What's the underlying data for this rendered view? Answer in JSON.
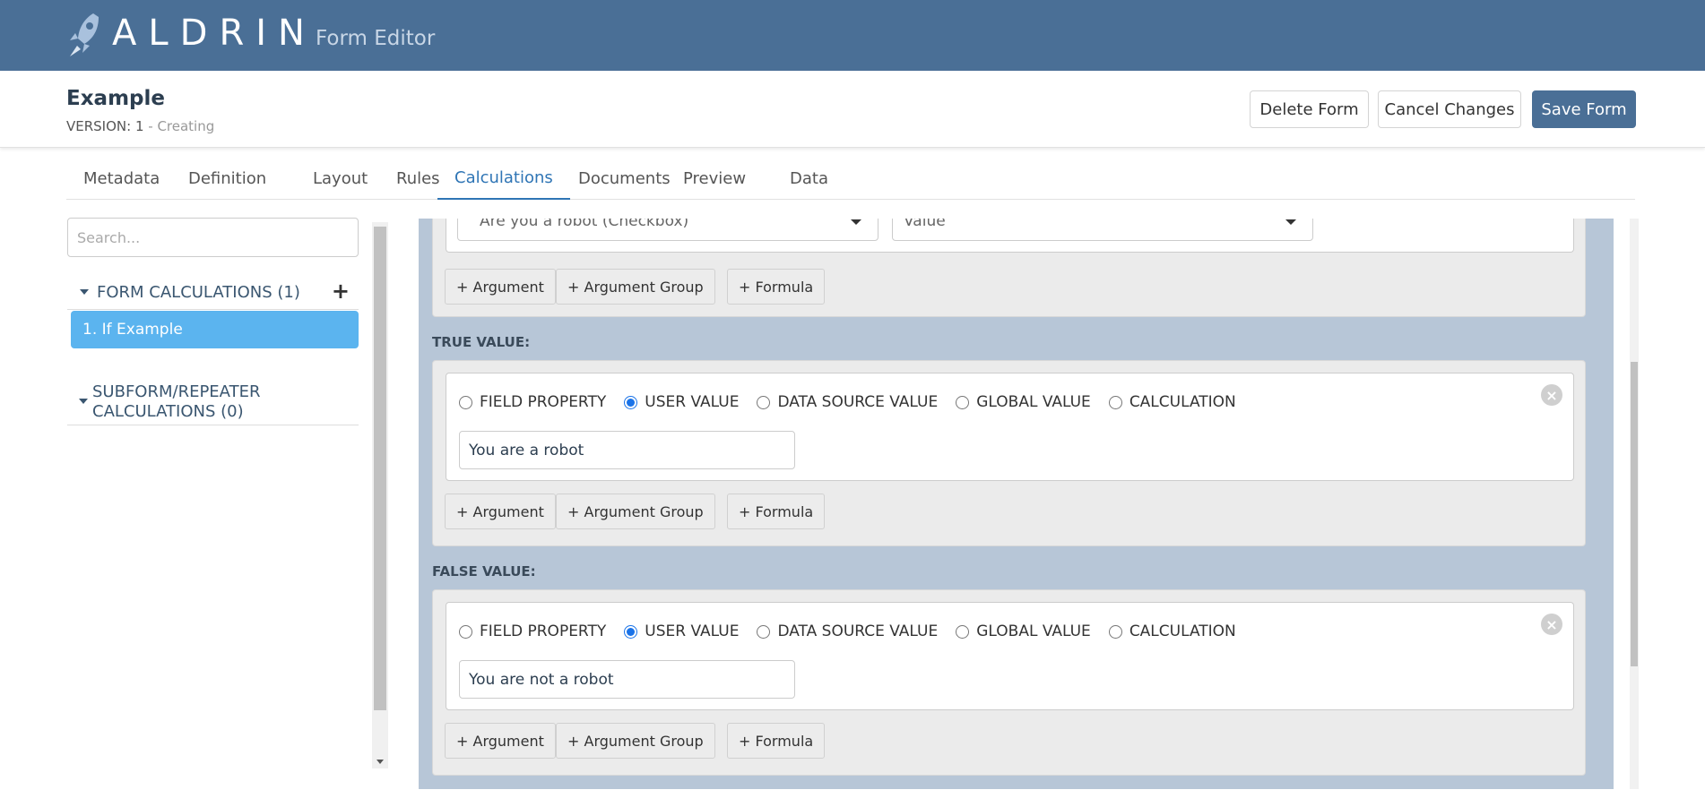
{
  "app": {
    "brand": "ALDRIN",
    "name": "Form Editor"
  },
  "form": {
    "title": "Example",
    "version_prefix": "VERSION: 1",
    "version_status": " - Creating"
  },
  "actions": {
    "delete": "Delete Form",
    "cancel": "Cancel Changes",
    "save": "Save Form"
  },
  "tabs": [
    "Metadata",
    "Definition",
    "Layout",
    "Rules",
    "Calculations",
    "Documents",
    "Preview",
    "Data"
  ],
  "active_tab": "Calculations",
  "sidebar": {
    "search_placeholder": "Search...",
    "form_calcs": "FORM CALCULATIONS (1)",
    "calc_item": "1.  If Example",
    "subform_line1": "SUBFORM/REPEATER",
    "subform_line2": "CALCULATIONS (0)"
  },
  "condition": {
    "field_select": "Are you a robot (Checkbox)",
    "prop_select": "Value"
  },
  "buttons": {
    "argument": "+ Argument",
    "argument_group": "+ Argument Group",
    "formula": "+ Formula"
  },
  "radio_labels": [
    "FIELD PROPERTY",
    "USER VALUE",
    "DATA SOURCE VALUE",
    "GLOBAL VALUE",
    "CALCULATION"
  ],
  "true_value": {
    "label": "TRUE VALUE:",
    "selected": "USER VALUE",
    "input": "You are a robot"
  },
  "false_value": {
    "label": "FALSE VALUE:",
    "selected": "USER VALUE",
    "input": "You are not a robot"
  },
  "colors": {
    "topbar": "#4a6f96",
    "accent": "#2f75b5",
    "selected_item": "#5bb4ef",
    "panel_bg": "#b7c6d7"
  }
}
